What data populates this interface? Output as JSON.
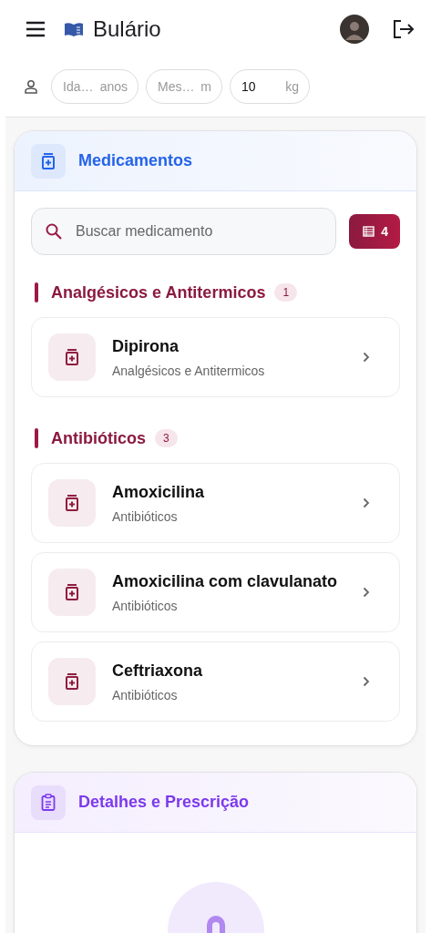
{
  "app_bar": {
    "title": "Bulário"
  },
  "patient_fields": [
    {
      "placeholder": "Ida…",
      "unit": "anos"
    },
    {
      "placeholder": "Mes…",
      "unit": "m"
    },
    {
      "value": "10",
      "unit": "kg"
    }
  ],
  "medications_card": {
    "title": "Medicamentos",
    "search": {
      "placeholder": "Buscar medicamento"
    },
    "count_button": "4",
    "groups": [
      {
        "name": "Analgésicos e Antitermicos",
        "count": "1",
        "items": [
          {
            "name": "Dipirona",
            "category": "Analgésicos e Antitermicos"
          }
        ]
      },
      {
        "name": "Antibióticos",
        "count": "3",
        "items": [
          {
            "name": "Amoxicilina",
            "category": "Antibióticos"
          },
          {
            "name": "Amoxicilina com clavulanato",
            "category": "Antibióticos"
          },
          {
            "name": "Ceftriaxona",
            "category": "Antibióticos"
          }
        ]
      }
    ]
  },
  "details_card": {
    "title": "Detalhes e Prescrição"
  }
}
